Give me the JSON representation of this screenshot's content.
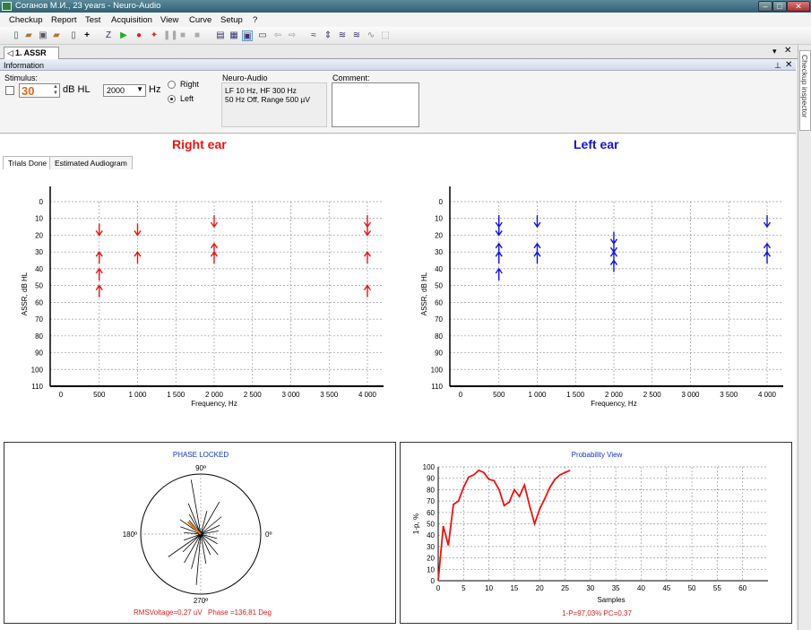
{
  "window": {
    "title": "Соганов М.И., 23 years - Neuro-Audio"
  },
  "menu": [
    "Checkup",
    "Report",
    "Test",
    "Acquisition",
    "View",
    "Curve",
    "Setup",
    "?"
  ],
  "document_tab": {
    "label": "1. ASSR"
  },
  "side_panel": {
    "label": "Checkup inspector"
  },
  "info": {
    "header": "Information",
    "stimulus_label": "Stimulus:",
    "intensity": "30",
    "intensity_unit": "dB HL",
    "frequency": "2000",
    "frequency_unit": "Hz",
    "radio_right": "Right",
    "radio_left": "Left",
    "radio_selected": "Left",
    "device_label": "Neuro-Audio",
    "device_line1": "LF  10 Hz, HF  300 Hz",
    "device_line2": "50 Hz  Off, Range 500 µV",
    "comment_label": "Comment:",
    "comment_value": ""
  },
  "tabs": [
    "Trials Done",
    "Estimated Audiogram"
  ],
  "right_ear": {
    "title": "Right ear",
    "color": "#ee1111",
    "ylabel": "ASSR, dB HL",
    "xlabel": "Frequency, Hz",
    "yticks": [
      "0",
      "10",
      "20",
      "30",
      "40",
      "50",
      "60",
      "70",
      "80",
      "90",
      "100",
      "110"
    ],
    "xticks": [
      "0",
      "500",
      "1 000",
      "1 500",
      "2 000",
      "2 500",
      "3 000",
      "3 500",
      "4 000"
    ],
    "markers": [
      {
        "freq": 500,
        "db": 20,
        "dir": "down"
      },
      {
        "freq": 500,
        "db": 30,
        "dir": "up"
      },
      {
        "freq": 500,
        "db": 40,
        "dir": "up"
      },
      {
        "freq": 500,
        "db": 50,
        "dir": "up"
      },
      {
        "freq": 1000,
        "db": 20,
        "dir": "down"
      },
      {
        "freq": 1000,
        "db": 30,
        "dir": "up"
      },
      {
        "freq": 2000,
        "db": 15,
        "dir": "down"
      },
      {
        "freq": 2000,
        "db": 25,
        "dir": "up"
      },
      {
        "freq": 2000,
        "db": 30,
        "dir": "up"
      },
      {
        "freq": 4000,
        "db": 15,
        "dir": "down"
      },
      {
        "freq": 4000,
        "db": 20,
        "dir": "down"
      },
      {
        "freq": 4000,
        "db": 30,
        "dir": "up"
      },
      {
        "freq": 4000,
        "db": 50,
        "dir": "up"
      }
    ]
  },
  "left_ear": {
    "title": "Left ear",
    "color": "#1111dd",
    "ylabel": "ASSR, dB HL",
    "xlabel": "Frequency, Hz",
    "yticks": [
      "0",
      "10",
      "20",
      "30",
      "40",
      "50",
      "60",
      "70",
      "80",
      "90",
      "100",
      "110"
    ],
    "xticks": [
      "0",
      "500",
      "1 000",
      "1 500",
      "2 000",
      "2 500",
      "3 000",
      "3 500",
      "4 000"
    ],
    "markers": [
      {
        "freq": 500,
        "db": 15,
        "dir": "down"
      },
      {
        "freq": 500,
        "db": 20,
        "dir": "down"
      },
      {
        "freq": 500,
        "db": 25,
        "dir": "up"
      },
      {
        "freq": 500,
        "db": 30,
        "dir": "up"
      },
      {
        "freq": 500,
        "db": 40,
        "dir": "up"
      },
      {
        "freq": 1000,
        "db": 15,
        "dir": "down"
      },
      {
        "freq": 1000,
        "db": 25,
        "dir": "up"
      },
      {
        "freq": 1000,
        "db": 30,
        "dir": "up"
      },
      {
        "freq": 2000,
        "db": 25,
        "dir": "down"
      },
      {
        "freq": 2000,
        "db": 30,
        "dir": "down"
      },
      {
        "freq": 2000,
        "db": 30,
        "dir": "up"
      },
      {
        "freq": 2000,
        "db": 35,
        "dir": "up"
      },
      {
        "freq": 4000,
        "db": 15,
        "dir": "down"
      },
      {
        "freq": 4000,
        "db": 25,
        "dir": "up"
      },
      {
        "freq": 4000,
        "db": 30,
        "dir": "up"
      }
    ]
  },
  "phase": {
    "title": "PHASE LOCKED",
    "label_90": "90º",
    "label_0": "0º",
    "label_180": "180º",
    "label_270": "270º",
    "footer_rms": "RMSVoltage=0,27 uV",
    "footer_phase": "Phase =136,81 Deg",
    "mean_vector": {
      "angle": 136.81,
      "length": 0.27
    },
    "vectors": [
      {
        "angle": 100,
        "length": 0.92
      },
      {
        "angle": 112,
        "length": 0.55
      },
      {
        "angle": 120,
        "length": 0.38
      },
      {
        "angle": 130,
        "length": 0.3
      },
      {
        "angle": 145,
        "length": 0.42
      },
      {
        "angle": 160,
        "length": 0.36
      },
      {
        "angle": 175,
        "length": 0.28
      },
      {
        "angle": 60,
        "length": 0.62
      },
      {
        "angle": 75,
        "length": 0.4
      },
      {
        "angle": 40,
        "length": 0.45
      },
      {
        "angle": 25,
        "length": 0.35
      },
      {
        "angle": 10,
        "length": 0.3
      },
      {
        "angle": 200,
        "length": 0.3
      },
      {
        "angle": 225,
        "length": 0.42
      },
      {
        "angle": 240,
        "length": 0.55
      },
      {
        "angle": 255,
        "length": 0.6
      },
      {
        "angle": 265,
        "length": 0.85
      },
      {
        "angle": 280,
        "length": 0.5
      },
      {
        "angle": 295,
        "length": 0.38
      },
      {
        "angle": 310,
        "length": 0.45
      },
      {
        "angle": 330,
        "length": 0.32
      },
      {
        "angle": 345,
        "length": 0.28
      },
      {
        "angle": 215,
        "length": 0.66
      }
    ]
  },
  "chart_data": {
    "type": "line",
    "title": "Probability View",
    "xlabel": "Samples",
    "ylabel": "1-p, %",
    "xlim": [
      0,
      65
    ],
    "ylim": [
      0,
      100
    ],
    "xticks": [
      "0",
      "5",
      "10",
      "15",
      "20",
      "25",
      "30",
      "35",
      "40",
      "45",
      "50",
      "55",
      "60"
    ],
    "yticks": [
      "0",
      "10",
      "20",
      "30",
      "40",
      "50",
      "60",
      "70",
      "80",
      "90",
      "100"
    ],
    "series": [
      {
        "color": "#ee1111",
        "x": [
          0,
          1,
          2,
          3,
          4,
          5,
          6,
          7,
          8,
          9,
          10,
          11,
          12,
          13,
          14,
          15,
          16,
          17,
          18,
          19,
          20,
          21,
          22,
          23,
          24,
          25,
          26
        ],
        "y": [
          0,
          48,
          31,
          67,
          70,
          82,
          91,
          93,
          97,
          95,
          89,
          88,
          80,
          66,
          69,
          80,
          74,
          84,
          66,
          50,
          63,
          72,
          82,
          89,
          93,
          95,
          97
        ]
      }
    ],
    "footer": "1-P=97,03%   PC=0,37",
    "grid": true
  }
}
